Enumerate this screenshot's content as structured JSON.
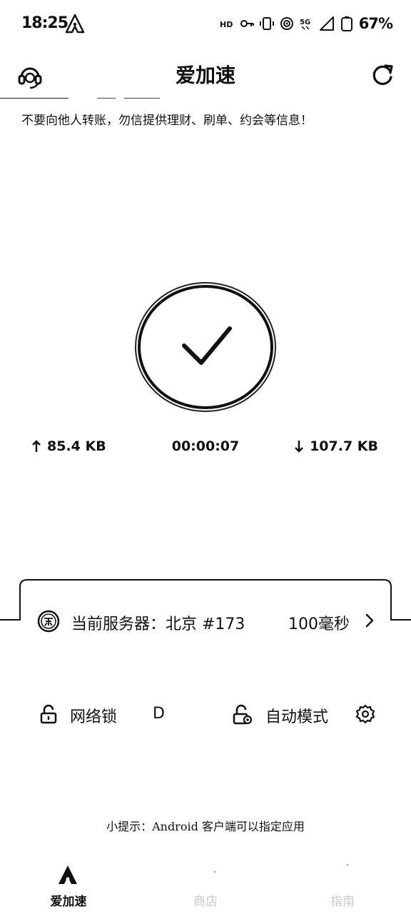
{
  "status_bar": {
    "time": "18:25",
    "battery_pct": "67%",
    "icons": [
      "app-a-icon",
      "hd-icon",
      "key-icon",
      "vibrate-icon",
      "wifi-icon",
      "5g-icon",
      "signal-icon",
      "battery-icon"
    ]
  },
  "header": {
    "title": "爱加速",
    "left_icon": "headset-support-icon",
    "right_icon": "refresh-icon"
  },
  "notice": {
    "text": "不要向他人转账，勿信提供理财、刷单、约会等信息！"
  },
  "connect": {
    "state": "connected",
    "icon": "check-icon"
  },
  "stats": {
    "upload": "85.4 KB",
    "timer": "00:00:07",
    "download": "107.7 KB"
  },
  "server": {
    "label": "当前服务器：北京 #173",
    "latency": "100毫秒"
  },
  "toggles": {
    "net_lock_label": "网络锁",
    "net_lock_state": "D",
    "auto_mode_label": "自动模式"
  },
  "tip": {
    "text": "小提示：Android 客户端可以指定应用"
  },
  "nav": {
    "items": [
      {
        "label": "爱加速",
        "active": true
      },
      {
        "label": "商店",
        "active": false
      },
      {
        "label": "指南",
        "active": false
      }
    ]
  },
  "colors": {
    "foreground": "#111111",
    "background": "#ffffff",
    "inactive": "#c8c8c8"
  }
}
